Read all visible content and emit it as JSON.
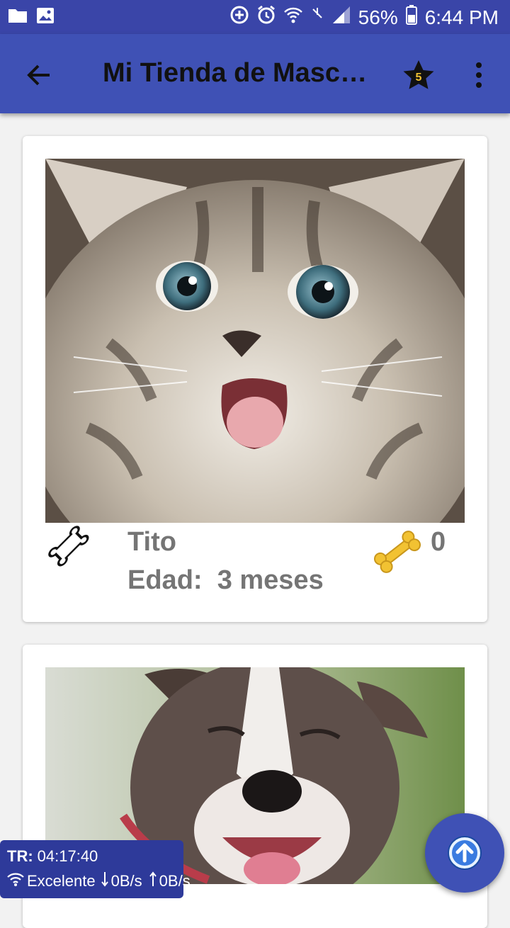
{
  "status_bar": {
    "battery": "56%",
    "time": "6:44 PM",
    "icons": [
      "folder-icon",
      "image-icon",
      "data-saver-icon",
      "alarm-icon",
      "wifi-icon",
      "no-signal-icon",
      "signal-icon",
      "battery-icon"
    ]
  },
  "app_bar": {
    "title": "Mi Tienda de Mascotas",
    "favorites_count": "5",
    "icons": [
      "back-arrow-icon",
      "star-icon",
      "more-vert-icon"
    ]
  },
  "pets": [
    {
      "name": "Tito",
      "age_label": "Edad:",
      "age_value": "3 meses",
      "likes": "0",
      "photo": "kitten"
    },
    {
      "photo": "dog"
    }
  ],
  "net_widget": {
    "tr_label": "TR:",
    "tr_value": "04:17:40",
    "quality": "Excelente",
    "down": "0B/s",
    "up": "0B/s"
  },
  "colors": {
    "status_bar": "#3a45a8",
    "app_bar": "#3f51b5",
    "text_secondary": "#757575",
    "bone_gold": "#f2c232"
  }
}
